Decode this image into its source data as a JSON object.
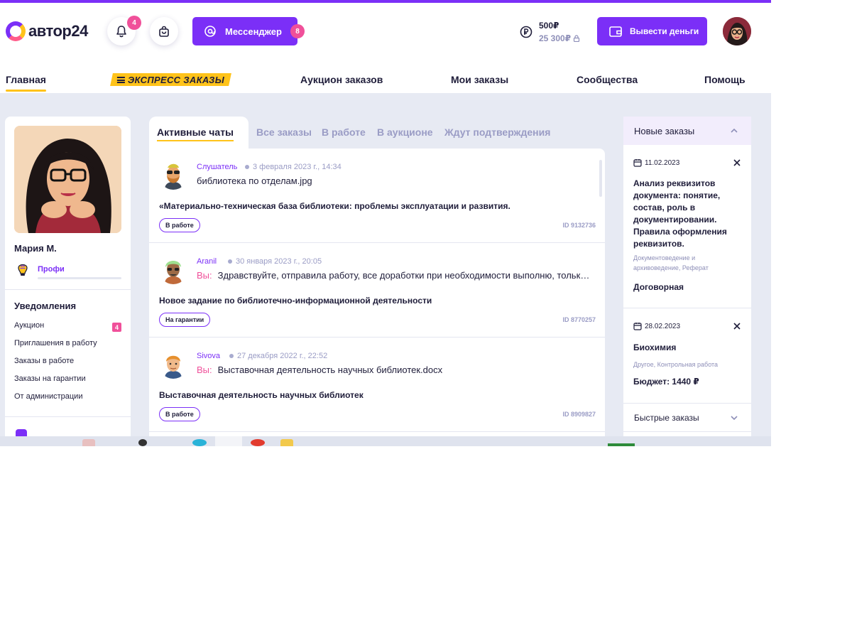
{
  "header": {
    "logo_text": "автор24",
    "notifications_count": "4",
    "messenger_label": "Мессенджер",
    "messenger_count": "8",
    "balance_main": "500₽",
    "balance_locked": "25 300₽",
    "withdraw_label": "Вывести деньги"
  },
  "nav": {
    "items": [
      "Главная",
      "ЭКСПРЕСС ЗАКАЗЫ",
      "Аукцион заказов",
      "Мои заказы",
      "Сообщества",
      "Помощь"
    ]
  },
  "profile": {
    "name": "Мария М.",
    "level": "Профи",
    "level_progress": 0,
    "notifications_title": "Уведомления",
    "notifications": [
      {
        "label": "Аукцион",
        "count": "4"
      },
      {
        "label": "Приглашения в работу"
      },
      {
        "label": "Заказы в работе"
      },
      {
        "label": "Заказы на гарантии"
      },
      {
        "label": "От администрации"
      }
    ]
  },
  "chat_tabs": [
    "Активные чаты",
    "Все заказы",
    "В работе",
    "В аукционе",
    "Ждут подтверждения"
  ],
  "chats": [
    {
      "sender": "Слушатель",
      "date": "3 февраля 2023 г., 14:34",
      "you_prefix": "",
      "message": "библиотека по отделам.jpg",
      "title": "«Материально-техническая база библиотеки: проблемы эксплуатации и развития.",
      "status": "В работе",
      "id": "ID 9132736"
    },
    {
      "sender": "Aranil",
      "date": "30 января 2023 г., 20:05",
      "you_prefix": "Вы:",
      "message": "Здравствуйте, отправила работу, все доработки при необходимости выполню, только пишите заранее",
      "title": "Новое задание по библиотечно-информационной деятельности",
      "status": "На гарантии",
      "id": "ID 8770257"
    },
    {
      "sender": "Sivova",
      "date": "27 декабря 2022 г., 22:52",
      "you_prefix": "Вы:",
      "message": "Выставочная деятельность научных библиотек.docx",
      "title": "Выставочная деятельность научных библиотек",
      "status": "В работе",
      "id": "ID 8909827"
    }
  ],
  "orders": {
    "header": "Новые заказы",
    "items": [
      {
        "date": "11.02.2023",
        "title": "Анализ реквизитов документа: понятие, состав, роль в документировании. Правила оформления реквизитов.",
        "subject": "Документоведение и архивоведение, Реферат",
        "budget": "Договорная"
      },
      {
        "date": "28.02.2023",
        "title": "Биохимия",
        "subject": "Другое, Контрольная работа",
        "budget": "Бюджет: 1440 ₽"
      }
    ],
    "quick_orders": "Быстрые заказы"
  },
  "colors": {
    "accent": "#7b2ff7",
    "yellow": "#ffc31a",
    "pink": "#f0509a",
    "background": "#e7eaf3"
  }
}
